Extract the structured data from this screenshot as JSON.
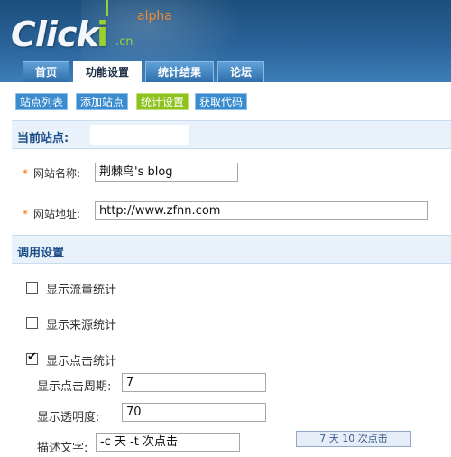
{
  "header": {
    "logo_text": "Click",
    "logo_i": "i",
    "logo_cn": ".cn",
    "logo_alpha": "alpha"
  },
  "tabs": [
    {
      "label": "首页",
      "active": false
    },
    {
      "label": "功能设置",
      "active": true
    },
    {
      "label": "统计结果",
      "active": false
    },
    {
      "label": "论坛",
      "active": false
    }
  ],
  "toolbar": {
    "buttons": [
      {
        "label": "站点列表",
        "color": "#3a8ccf"
      },
      {
        "label": "添加站点",
        "color": "#3a8ccf"
      },
      {
        "label": "统计设置",
        "color": "#8ec31f"
      },
      {
        "label": "获取代码",
        "color": "#3a8ccf"
      }
    ]
  },
  "current_site": {
    "heading": "当前站点:"
  },
  "form": {
    "site_name_label": "网站名称:",
    "site_name_value": "荆棘鸟's blog",
    "site_url_label": "网站地址:",
    "site_url_value": "http://www.zfnn.com",
    "required_mark": "*"
  },
  "settings": {
    "heading": "调用设置",
    "options": [
      {
        "label": "显示流量统计",
        "checked": false
      },
      {
        "label": "显示来源统计",
        "checked": false
      },
      {
        "label": "显示点击统计",
        "checked": true
      }
    ],
    "check_mark": "✔",
    "period_label": "显示点击周期:",
    "period_value": "7",
    "opacity_label": "显示透明度:",
    "opacity_value": "70",
    "desc_label": "描述文字:",
    "desc_value": "-c 天 -t 次点击",
    "preview_text": "7 天 10 次点击"
  },
  "colors": {
    "header_blue": "#2a6399",
    "accent_green": "#8ec31f",
    "accent_orange": "#f08a2c",
    "section_bg": "#e9f2fb",
    "section_text": "#1d4f8a"
  }
}
